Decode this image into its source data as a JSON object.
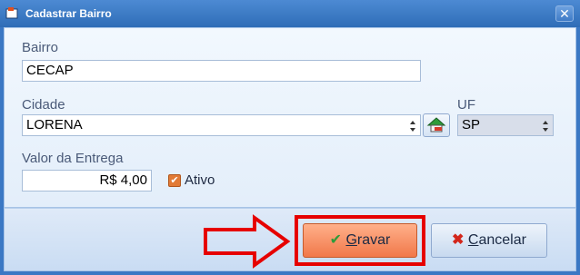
{
  "window": {
    "title": "Cadastrar Bairro",
    "close_glyph": "✕"
  },
  "form": {
    "bairro_label": "Bairro",
    "bairro_value": "CECAP",
    "cidade_label": "Cidade",
    "cidade_value": "LORENA",
    "uf_label": "UF",
    "uf_value": "SP",
    "valor_label": "Valor da Entrega",
    "valor_value": "R$ 4,00",
    "ativo_label": "Ativo",
    "ativo_checked": true
  },
  "footer": {
    "gravar_first": "G",
    "gravar_rest": "ravar",
    "cancelar_first": "C",
    "cancelar_rest": "ancelar"
  },
  "colors": {
    "highlight": "#e60000",
    "gravar_bg": "#f1784a",
    "accent": "#3b78c4"
  },
  "icons": [
    "app-icon",
    "close-icon",
    "spin-arrows-icon",
    "add-city-icon",
    "checkmark-icon",
    "x-icon",
    "arrow-annotation"
  ]
}
